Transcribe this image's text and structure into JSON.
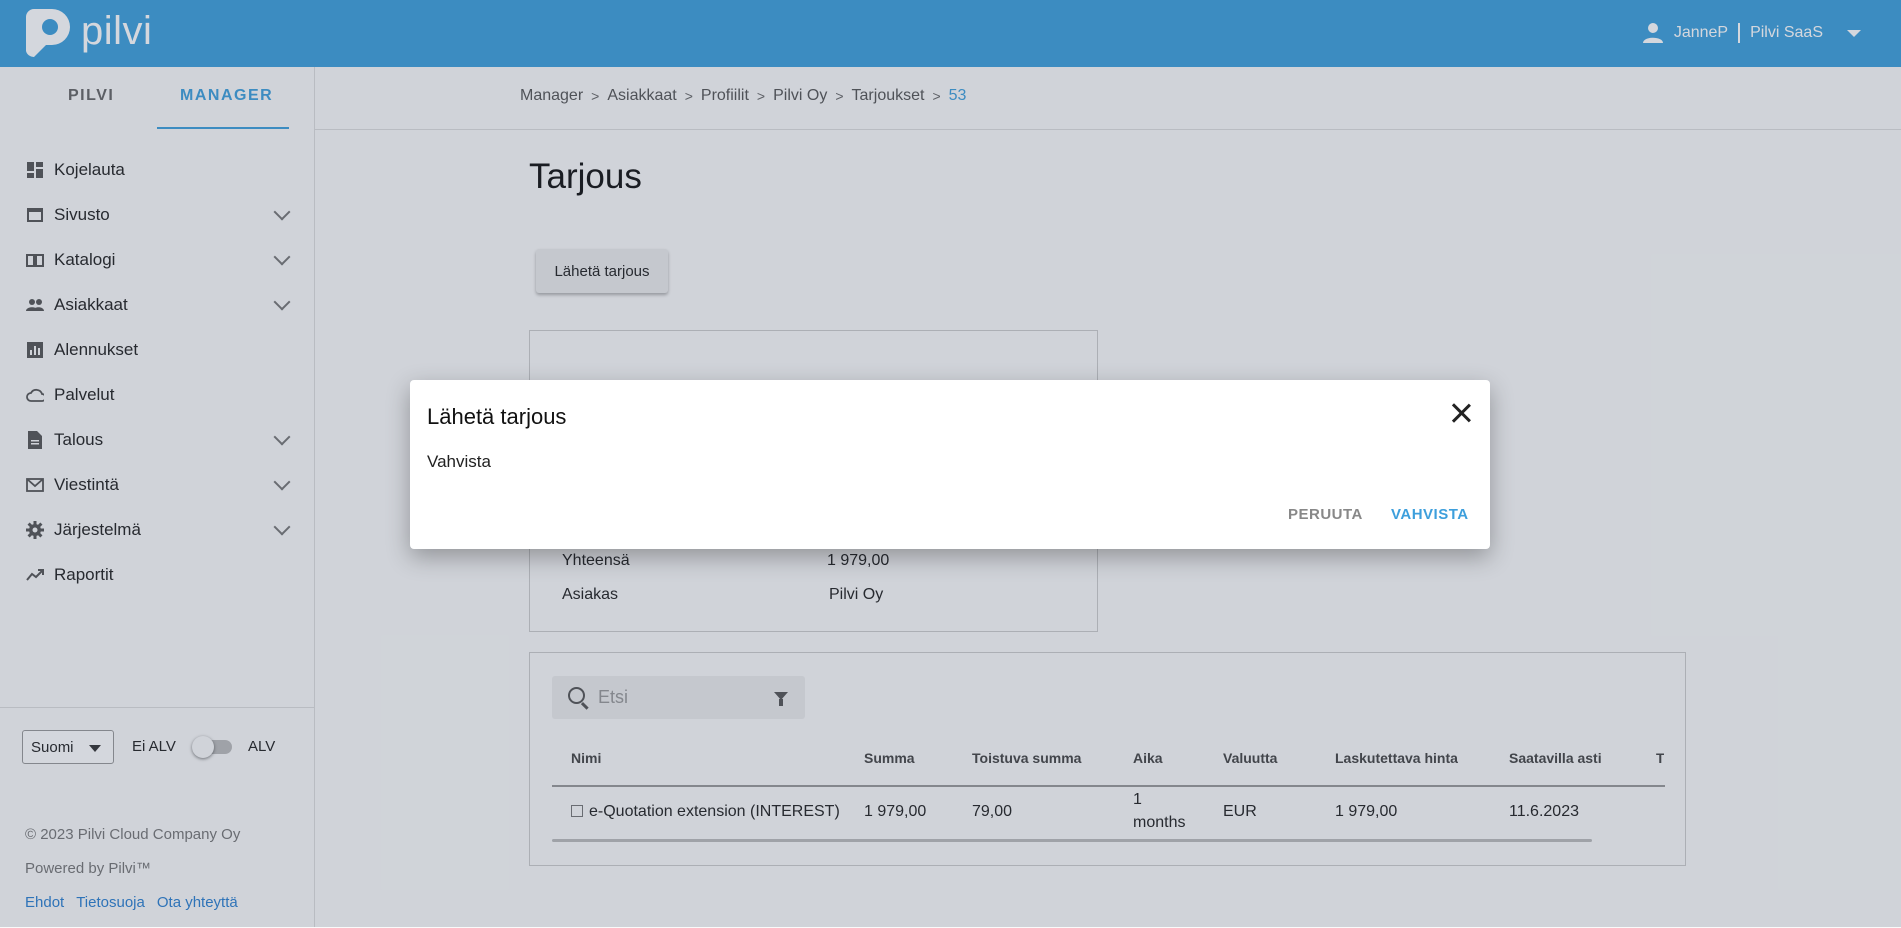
{
  "app": {
    "logo_text": "pilvi"
  },
  "user": {
    "name": "JanneP",
    "org": "Pilvi SaaS"
  },
  "sidebar": {
    "tabs": [
      {
        "label": "PILVI"
      },
      {
        "label": "MANAGER"
      }
    ],
    "items": [
      {
        "label": "Kojelauta",
        "icon": "dashboard-icon"
      },
      {
        "label": "Sivusto",
        "icon": "window-icon"
      },
      {
        "label": "Katalogi",
        "icon": "book-icon"
      },
      {
        "label": "Asiakkaat",
        "icon": "people-icon"
      },
      {
        "label": "Alennukset",
        "icon": "chart-box-icon"
      },
      {
        "label": "Palvelut",
        "icon": "cloud-icon"
      },
      {
        "label": "Talous",
        "icon": "document-icon"
      },
      {
        "label": "Viestintä",
        "icon": "mail-icon"
      },
      {
        "label": "Järjestelmä",
        "icon": "gear-icon"
      },
      {
        "label": "Raportit",
        "icon": "trending-icon"
      }
    ],
    "language": "Suomi",
    "vat_off_label": "Ei ALV",
    "vat_on_label": "ALV",
    "copyright": "© 2023 Pilvi Cloud Company Oy",
    "powered_by": "Powered by Pilvi™",
    "links": [
      "Ehdot",
      "Tietosuoja",
      "Ota yhteyttä"
    ]
  },
  "breadcrumb": [
    "Manager",
    "Asiakkaat",
    "Profiilit",
    "Pilvi Oy",
    "Tarjoukset",
    "53"
  ],
  "page": {
    "title": "Tarjous",
    "send_button": "Lähetä tarjous",
    "info": [
      {
        "label": "Yhteensä",
        "value": "1 979,00"
      },
      {
        "label": "Asiakas",
        "value": "Pilvi Oy"
      }
    ]
  },
  "table": {
    "search_placeholder": "Etsi",
    "columns": [
      "Nimi",
      "Summa",
      "Toistuva summa",
      "Aika",
      "Valuutta",
      "Laskutettava hinta",
      "Saatavilla asti",
      "T"
    ],
    "rows": [
      {
        "name": "e-Quotation extension (INTEREST)",
        "sum": "1 979,00",
        "recurring": "79,00",
        "time_value": "1",
        "time_unit": "months",
        "currency": "EUR",
        "billable": "1 979,00",
        "available_until": "11.6.2023"
      }
    ]
  },
  "dialog": {
    "title": "Lähetä tarjous",
    "body": "Vahvista",
    "cancel": "PERUUTA",
    "confirm": "VAHVISTA"
  },
  "colors": {
    "accent": "#3d9fdc",
    "topbar": "#3d9fdc"
  }
}
